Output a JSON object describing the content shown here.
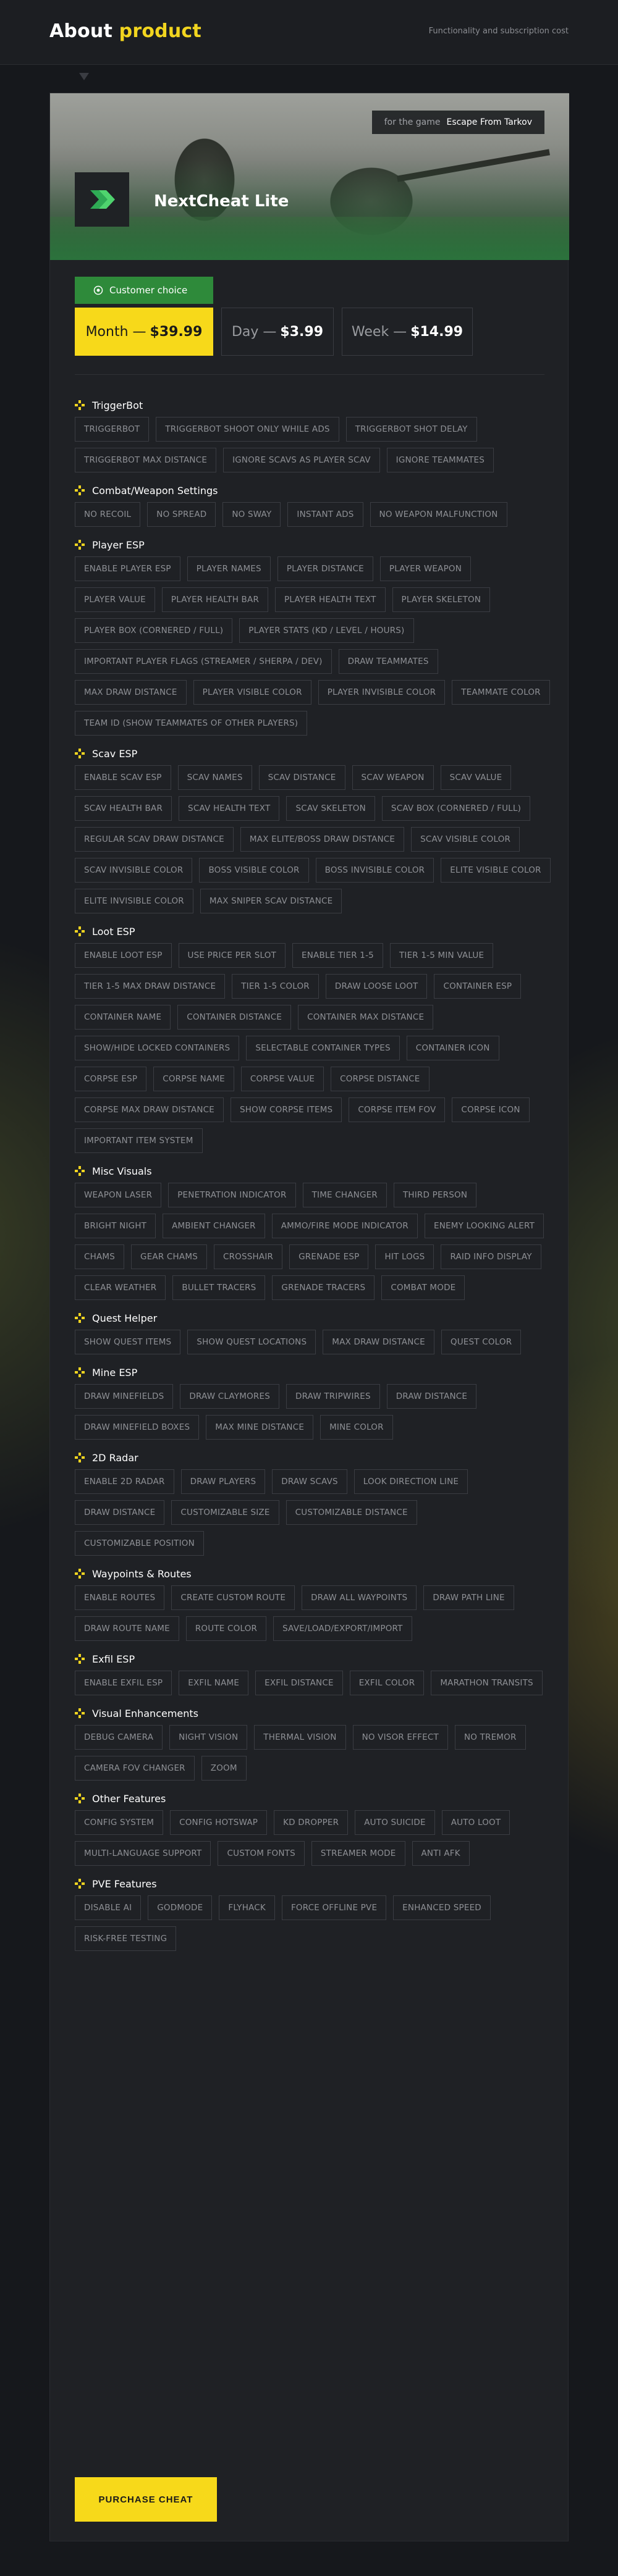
{
  "header": {
    "title_prefix": "About",
    "title_accent": "product",
    "subtitle": "Functionality and subscription cost"
  },
  "hero": {
    "game_label": "for the game",
    "game_name": "Escape From Tarkov",
    "product_name": "NextCheat Lite",
    "logo_icon": "nextcheat-logo-icon"
  },
  "colors": {
    "accent": "#f7d91a",
    "choice_green": "#2e8a3a"
  },
  "choice_badge": "Customer choice",
  "plans": [
    {
      "period": "Month",
      "price": "$39.99",
      "active": true
    },
    {
      "period": "Day",
      "price": "$3.99",
      "active": false
    },
    {
      "period": "Week",
      "price": "$14.99",
      "active": false
    }
  ],
  "sections": [
    {
      "title": "TriggerBot",
      "items": [
        "TRIGGERBOT",
        "TRIGGERBOT SHOOT ONLY WHILE ADS",
        "TRIGGERBOT SHOT DELAY",
        "TRIGGERBOT MAX DISTANCE",
        "IGNORE SCAVS AS PLAYER SCAV",
        "IGNORE TEAMMATES"
      ]
    },
    {
      "title": "Combat/Weapon Settings",
      "items": [
        "NO RECOIL",
        "NO SPREAD",
        "NO SWAY",
        "INSTANT ADS",
        "NO WEAPON MALFUNCTION"
      ]
    },
    {
      "title": "Player ESP",
      "items": [
        "ENABLE PLAYER ESP",
        "PLAYER NAMES",
        "PLAYER DISTANCE",
        "PLAYER WEAPON",
        "PLAYER VALUE",
        "PLAYER HEALTH BAR",
        "PLAYER HEALTH TEXT",
        "PLAYER SKELETON",
        "PLAYER BOX (CORNERED / FULL)",
        "PLAYER STATS (KD / LEVEL / HOURS)",
        "IMPORTANT PLAYER FLAGS (STREAMER / SHERPA / DEV)",
        "DRAW TEAMMATES",
        "MAX DRAW DISTANCE",
        "PLAYER VISIBLE COLOR",
        "PLAYER INVISIBLE COLOR",
        "TEAMMATE COLOR",
        "TEAM ID (SHOW TEAMMATES OF OTHER PLAYERS)"
      ]
    },
    {
      "title": "Scav ESP",
      "items": [
        "ENABLE SCAV ESP",
        "SCAV NAMES",
        "SCAV DISTANCE",
        "SCAV WEAPON",
        "SCAV VALUE",
        "SCAV HEALTH BAR",
        "SCAV HEALTH TEXT",
        "SCAV SKELETON",
        "SCAV BOX (CORNERED / FULL)",
        "REGULAR SCAV DRAW DISTANCE",
        "MAX ELITE/BOSS DRAW DISTANCE",
        "SCAV VISIBLE COLOR",
        "SCAV INVISIBLE COLOR",
        "BOSS VISIBLE COLOR",
        "BOSS INVISIBLE COLOR",
        "ELITE VISIBLE COLOR",
        "ELITE INVISIBLE COLOR",
        "MAX SNIPER SCAV DISTANCE"
      ]
    },
    {
      "title": "Loot ESP",
      "items": [
        "ENABLE LOOT ESP",
        "USE PRICE PER SLOT",
        "ENABLE TIER 1-5",
        "TIER 1-5 MIN VALUE",
        "TIER 1-5 MAX DRAW DISTANCE",
        "TIER 1-5 COLOR",
        "DRAW LOOSE LOOT",
        "CONTAINER ESP",
        "CONTAINER NAME",
        "CONTAINER DISTANCE",
        "CONTAINER MAX DISTANCE",
        "SHOW/HIDE LOCKED CONTAINERS",
        "SELECTABLE CONTAINER TYPES",
        "CONTAINER ICON",
        "CORPSE ESP",
        "CORPSE NAME",
        "CORPSE VALUE",
        "CORPSE DISTANCE",
        "CORPSE MAX DRAW DISTANCE",
        "SHOW CORPSE ITEMS",
        "CORPSE ITEM FOV",
        "CORPSE ICON",
        "IMPORTANT ITEM SYSTEM"
      ]
    },
    {
      "title": "Misc Visuals",
      "items": [
        "WEAPON LASER",
        "PENETRATION INDICATOR",
        "TIME CHANGER",
        "THIRD PERSON",
        "BRIGHT NIGHT",
        "AMBIENT CHANGER",
        "AMMO/FIRE MODE INDICATOR",
        "ENEMY LOOKING ALERT",
        "CHAMS",
        "GEAR CHAMS",
        "CROSSHAIR",
        "GRENADE ESP",
        "HIT LOGS",
        "RAID INFO DISPLAY",
        "CLEAR WEATHER",
        "BULLET TRACERS",
        "GRENADE TRACERS",
        "COMBAT MODE"
      ]
    },
    {
      "title": "Quest Helper",
      "items": [
        "SHOW QUEST ITEMS",
        "SHOW QUEST LOCATIONS",
        "MAX DRAW DISTANCE",
        "QUEST COLOR"
      ]
    },
    {
      "title": "Mine ESP",
      "items": [
        "DRAW MINEFIELDS",
        "DRAW CLAYMORES",
        "DRAW TRIPWIRES",
        "DRAW DISTANCE",
        "DRAW MINEFIELD BOXES",
        "MAX MINE DISTANCE",
        "MINE COLOR"
      ]
    },
    {
      "title": "2D Radar",
      "items": [
        "ENABLE 2D RADAR",
        "DRAW PLAYERS",
        "DRAW SCAVS",
        "LOOK DIRECTION LINE",
        "DRAW DISTANCE",
        "CUSTOMIZABLE SIZE",
        "CUSTOMIZABLE DISTANCE",
        "CUSTOMIZABLE POSITION"
      ]
    },
    {
      "title": "Waypoints & Routes",
      "items": [
        "ENABLE ROUTES",
        "CREATE CUSTOM ROUTE",
        "DRAW ALL WAYPOINTS",
        "DRAW PATH LINE",
        "DRAW ROUTE NAME",
        "ROUTE COLOR",
        "SAVE/LOAD/EXPORT/IMPORT"
      ]
    },
    {
      "title": "Exfil ESP",
      "items": [
        "ENABLE EXFIL ESP",
        "EXFIL NAME",
        "EXFIL DISTANCE",
        "EXFIL COLOR",
        "MARATHON TRANSITS"
      ]
    },
    {
      "title": "Visual Enhancements",
      "items": [
        "DEBUG CAMERA",
        "NIGHT VISION",
        "THERMAL VISION",
        "NO VISOR EFFECT",
        "NO TREMOR",
        "CAMERA FOV CHANGER",
        "ZOOM"
      ]
    },
    {
      "title": "Other Features",
      "items": [
        "CONFIG SYSTEM",
        "CONFIG HOTSWAP",
        "KD DROPPER",
        "AUTO SUICIDE",
        "AUTO LOOT",
        "MULTI-LANGUAGE SUPPORT",
        "CUSTOM FONTS",
        "STREAMER MODE",
        "ANTI AFK"
      ]
    },
    {
      "title": "PVE Features",
      "items": [
        "DISABLE AI",
        "GODMODE",
        "FLYHACK",
        "FORCE OFFLINE PVE",
        "ENHANCED SPEED",
        "RISK-FREE TESTING"
      ]
    }
  ],
  "purchase_label": "PURCHASE CHEAT"
}
